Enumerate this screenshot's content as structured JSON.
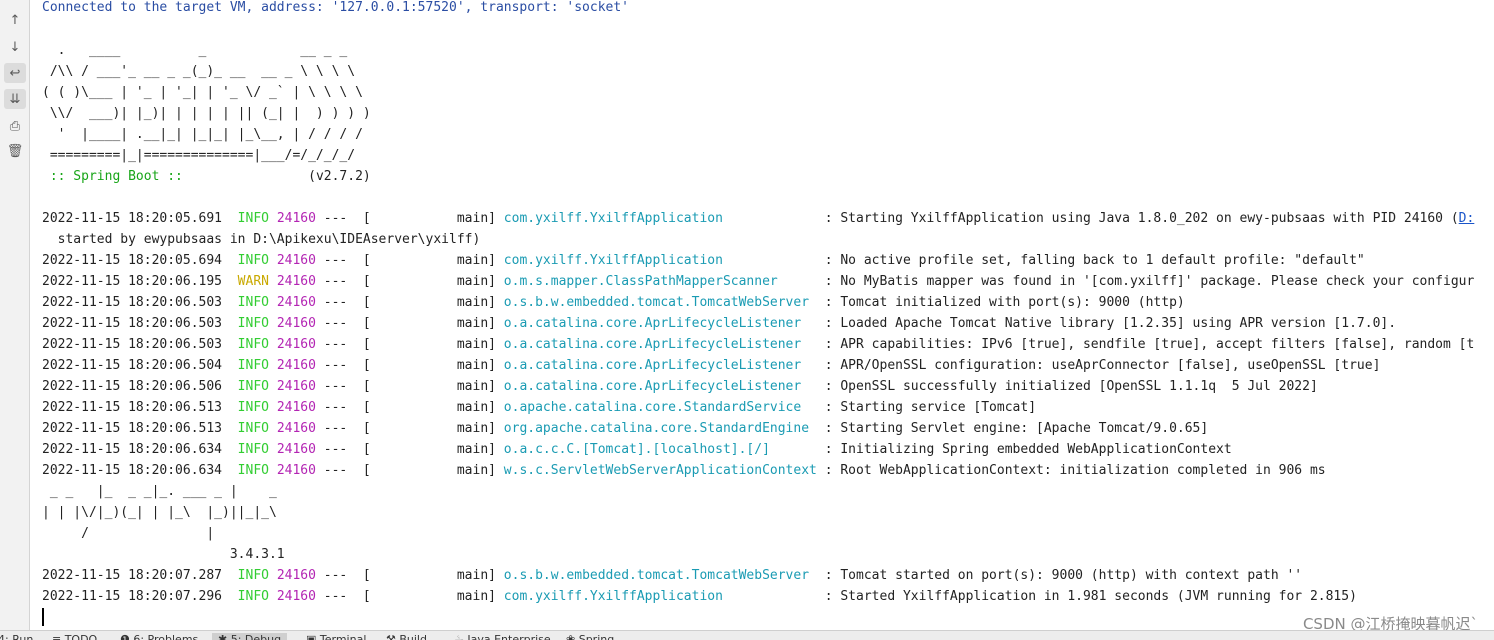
{
  "toolbar": {
    "icons": [
      "up-arrow-icon",
      "down-arrow-icon",
      "soft-wrap-icon",
      "scroll-to-end-icon",
      "print-icon",
      "trash-icon"
    ],
    "glyphs": [
      "↑",
      "↓",
      "↩",
      "⇊",
      "⎙",
      "🗑"
    ]
  },
  "console": {
    "connection": "Connected to the target VM, address: '127.0.0.1:57520', transport: 'socket'",
    "banner": [
      "  .   ____          _            __ _ _",
      " /\\\\ / ___'_ __ _ _(_)_ __  __ _ \\ \\ \\ \\",
      "( ( )\\___ | '_ | '_| | '_ \\/ _` | \\ \\ \\ \\",
      " \\\\/  ___)| |_)| | | | | || (_| |  ) ) ) )",
      "  '  |____| .__|_| |_|_| |_\\__, | / / / /",
      " =========|_|==============|___/=/_/_/_/"
    ],
    "spring_label": " :: Spring Boot :: ",
    "spring_version": "               (v2.7.2)",
    "started_by": "  started by ewypubsaas in D:\\Apikexu\\IDEAserver\\yxilff)",
    "logs1": [
      {
        "ts": "2022-11-15 18:20:05.691",
        "level": "INFO",
        "pid": "24160",
        "thread": "---  [           main] ",
        "logger": "com.yxilff.YxilffApplication            ",
        "msg": " : Starting YxilffApplication using Java 1.8.0_202 on ewy-pubsaas with PID 24160 (",
        "link": "D:"
      },
      {
        "ts": "2022-11-15 18:20:05.694",
        "level": "INFO",
        "pid": "24160",
        "thread": "---  [           main] ",
        "logger": "com.yxilff.YxilffApplication            ",
        "msg": " : No active profile set, falling back to 1 default profile: \"default\""
      },
      {
        "ts": "2022-11-15 18:20:06.195",
        "level": "WARN",
        "pid": "24160",
        "thread": "---  [           main] ",
        "logger": "o.m.s.mapper.ClassPathMapperScanner     ",
        "msg": " : No MyBatis mapper was found in '[com.yxilff]' package. Please check your configur"
      },
      {
        "ts": "2022-11-15 18:20:06.503",
        "level": "INFO",
        "pid": "24160",
        "thread": "---  [           main] ",
        "logger": "o.s.b.w.embedded.tomcat.TomcatWebServer ",
        "msg": " : Tomcat initialized with port(s): 9000 (http)"
      },
      {
        "ts": "2022-11-15 18:20:06.503",
        "level": "INFO",
        "pid": "24160",
        "thread": "---  [           main] ",
        "logger": "o.a.catalina.core.AprLifecycleListener  ",
        "msg": " : Loaded Apache Tomcat Native library [1.2.35] using APR version [1.7.0]."
      },
      {
        "ts": "2022-11-15 18:20:06.503",
        "level": "INFO",
        "pid": "24160",
        "thread": "---  [           main] ",
        "logger": "o.a.catalina.core.AprLifecycleListener  ",
        "msg": " : APR capabilities: IPv6 [true], sendfile [true], accept filters [false], random [t"
      },
      {
        "ts": "2022-11-15 18:20:06.504",
        "level": "INFO",
        "pid": "24160",
        "thread": "---  [           main] ",
        "logger": "o.a.catalina.core.AprLifecycleListener  ",
        "msg": " : APR/OpenSSL configuration: useAprConnector [false], useOpenSSL [true]"
      },
      {
        "ts": "2022-11-15 18:20:06.506",
        "level": "INFO",
        "pid": "24160",
        "thread": "---  [           main] ",
        "logger": "o.a.catalina.core.AprLifecycleListener  ",
        "msg": " : OpenSSL successfully initialized [OpenSSL 1.1.1q  5 Jul 2022]"
      },
      {
        "ts": "2022-11-15 18:20:06.513",
        "level": "INFO",
        "pid": "24160",
        "thread": "---  [           main] ",
        "logger": "o.apache.catalina.core.StandardService  ",
        "msg": " : Starting service [Tomcat]"
      },
      {
        "ts": "2022-11-15 18:20:06.513",
        "level": "INFO",
        "pid": "24160",
        "thread": "---  [           main] ",
        "logger": "org.apache.catalina.core.StandardEngine ",
        "msg": " : Starting Servlet engine: [Apache Tomcat/9.0.65]"
      },
      {
        "ts": "2022-11-15 18:20:06.634",
        "level": "INFO",
        "pid": "24160",
        "thread": "---  [           main] ",
        "logger": "o.a.c.c.C.[Tomcat].[localhost].[/]      ",
        "msg": " : Initializing Spring embedded WebApplicationContext"
      },
      {
        "ts": "2022-11-15 18:20:06.634",
        "level": "INFO",
        "pid": "24160",
        "thread": "---  [           main] ",
        "logger": "w.s.c.ServletWebServerApplicationContext",
        "msg": " : Root WebApplicationContext: initialization completed in 906 ms"
      }
    ],
    "mybatis_banner": [
      " _ _   |_  _ _|_. ___ _ |    _",
      "| | |\\/|_)(_| | |_\\  |_)||_|_\\",
      "     /               |",
      "                        3.4.3.1"
    ],
    "logs2": [
      {
        "ts": "2022-11-15 18:20:07.287",
        "level": "INFO",
        "pid": "24160",
        "thread": "---  [           main] ",
        "logger": "o.s.b.w.embedded.tomcat.TomcatWebServer ",
        "msg": " : Tomcat started on port(s): 9000 (http) with context path ''"
      },
      {
        "ts": "2022-11-15 18:20:07.296",
        "level": "INFO",
        "pid": "24160",
        "thread": "---  [           main] ",
        "logger": "com.yxilff.YxilffApplication            ",
        "msg": " : Started YxilffApplication in 1.981 seconds (JVM running for 2.815)"
      }
    ]
  },
  "watermark": "CSDN @江桥掩映暮帆迟`",
  "bottom_tabs": [
    {
      "label": "4: Run",
      "active": false
    },
    {
      "label": "≡ TODO",
      "active": false
    },
    {
      "label": "❶ 6: Problems",
      "active": false
    },
    {
      "label": "✱ 5: Debug",
      "active": true
    },
    {
      "label": "▣ Terminal",
      "active": false
    },
    {
      "label": "⚒ Build",
      "active": false
    },
    {
      "label": "☕ Java Enterprise",
      "active": false
    },
    {
      "label": "❀ Spring",
      "active": false
    }
  ],
  "colors": {
    "info": "#32cd32",
    "warn": "#c9a900",
    "pid": "#b324b3",
    "logger": "#1a9bb3",
    "connection": "#2a4da3",
    "spring_boot": "#18a518"
  }
}
